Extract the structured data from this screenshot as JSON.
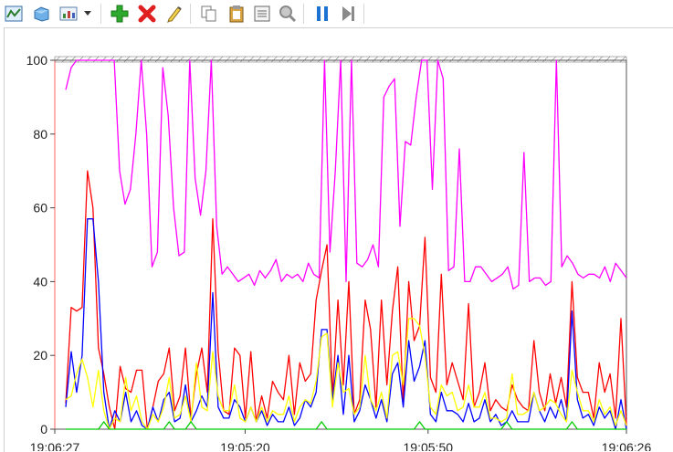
{
  "toolbar": {
    "buttons": [
      {
        "name": "view-graph-button",
        "icon": "graph-view-icon"
      },
      {
        "name": "view-histogram-button",
        "icon": "histogram-view-icon"
      },
      {
        "name": "view-report-button",
        "icon": "report-view-icon"
      },
      {
        "name": "view-dropdown-button",
        "icon": "chevron-down-icon"
      },
      {
        "name": "add-counter-button",
        "icon": "plus-icon"
      },
      {
        "name": "delete-counter-button",
        "icon": "delete-x-icon"
      },
      {
        "name": "highlight-button",
        "icon": "highlighter-icon"
      },
      {
        "name": "copy-properties-button",
        "icon": "copy-icon"
      },
      {
        "name": "paste-counter-list-button",
        "icon": "paste-icon"
      },
      {
        "name": "properties-button",
        "icon": "properties-icon"
      },
      {
        "name": "zoom-button",
        "icon": "magnifier-icon"
      },
      {
        "name": "freeze-display-button",
        "icon": "pause-icon"
      },
      {
        "name": "update-data-button",
        "icon": "step-forward-icon"
      }
    ]
  },
  "chart_data": {
    "type": "line",
    "title": "",
    "xlabel": "",
    "ylabel": "",
    "ylim": [
      0,
      100
    ],
    "yticks": [
      0,
      20,
      40,
      60,
      80,
      100
    ],
    "x_tick_labels": [
      "19:06:27",
      "19:05:20",
      "19:05:50",
      "19:06:26"
    ],
    "grid": false,
    "series": [
      {
        "color": "#ff00ff",
        "values": [
          92,
          98,
          100,
          100,
          100,
          100,
          100,
          100,
          100,
          100,
          70,
          61,
          65,
          80,
          100,
          80,
          44,
          48,
          98,
          85,
          60,
          47,
          48,
          100,
          68,
          58,
          70,
          100,
          55,
          42,
          44,
          42,
          40,
          41,
          42,
          39,
          43,
          41,
          43,
          46,
          40,
          42,
          41,
          42,
          40,
          45,
          42,
          41,
          100,
          48,
          70,
          100,
          40,
          100,
          45,
          44,
          46,
          50,
          44,
          90,
          93,
          95,
          55,
          78,
          77,
          90,
          100,
          100,
          65,
          100,
          95,
          43,
          44,
          76,
          40,
          40,
          44,
          44,
          42,
          40,
          41,
          42,
          44,
          38,
          39,
          75,
          40,
          41,
          41,
          39,
          40,
          100,
          44,
          47,
          45,
          42,
          41,
          42,
          42,
          41,
          44,
          40,
          45,
          43,
          41
        ]
      },
      {
        "color": "#ff0000",
        "values": [
          7,
          33,
          32,
          33,
          70,
          60,
          22,
          15,
          6,
          0,
          17,
          11,
          10,
          16,
          16,
          0,
          6,
          13,
          15,
          22,
          5,
          9,
          22,
          3,
          15,
          22,
          10,
          57,
          21,
          5,
          4,
          22,
          20,
          3,
          21,
          2,
          9,
          3,
          13,
          10,
          8,
          20,
          4,
          18,
          13,
          15,
          35,
          43,
          50,
          9,
          35,
          12,
          40,
          4,
          8,
          35,
          27,
          6,
          35,
          12,
          32,
          44,
          7,
          40,
          24,
          28,
          52,
          14,
          10,
          42,
          12,
          18,
          13,
          8,
          34,
          6,
          10,
          18,
          5,
          8,
          6,
          5,
          12,
          8,
          6,
          5,
          24,
          10,
          5,
          15,
          7,
          14,
          6,
          40,
          14,
          10,
          10,
          3,
          18,
          10,
          15,
          3,
          30,
          1
        ]
      },
      {
        "color": "#0000ff",
        "values": [
          6,
          21,
          10,
          20,
          57,
          57,
          40,
          10,
          0,
          5,
          2,
          10,
          2,
          5,
          1,
          0,
          6,
          2,
          8,
          10,
          2,
          3,
          12,
          2,
          5,
          9,
          6,
          37,
          6,
          3,
          3,
          8,
          6,
          2,
          6,
          2,
          5,
          1,
          4,
          2,
          2,
          6,
          1,
          3,
          8,
          6,
          10,
          27,
          27,
          8,
          20,
          4,
          20,
          2,
          5,
          12,
          8,
          3,
          8,
          2,
          15,
          18,
          6,
          24,
          13,
          17,
          24,
          4,
          2,
          10,
          5,
          5,
          4,
          2,
          7,
          2,
          3,
          8,
          2,
          4,
          1,
          2,
          5,
          2,
          2,
          2,
          10,
          5,
          2,
          6,
          3,
          8,
          2,
          32,
          8,
          3,
          4,
          1,
          6,
          3,
          5,
          0,
          8,
          0
        ]
      },
      {
        "color": "#ffff00",
        "values": [
          8,
          9,
          15,
          19,
          14,
          6,
          16,
          5,
          0,
          3,
          2,
          14,
          5,
          9,
          2,
          0,
          4,
          2,
          6,
          14,
          3,
          4,
          9,
          2,
          18,
          6,
          5,
          21,
          9,
          5,
          5,
          12,
          3,
          2,
          6,
          2,
          6,
          2,
          5,
          4,
          4,
          9,
          2,
          6,
          8,
          7,
          13,
          25,
          26,
          6,
          18,
          10,
          11,
          4,
          6,
          20,
          8,
          5,
          10,
          3,
          20,
          21,
          12,
          30,
          30,
          28,
          20,
          6,
          4,
          12,
          9,
          10,
          5,
          6,
          12,
          6,
          6,
          10,
          3,
          3,
          2,
          3,
          15,
          4,
          4,
          5,
          10,
          5,
          6,
          8,
          7,
          4,
          2,
          16,
          10,
          5,
          5,
          2,
          8,
          4,
          6,
          1,
          5,
          1
        ]
      },
      {
        "color": "#00cc00",
        "values": [
          0,
          0,
          0,
          0,
          0,
          0,
          0,
          2,
          0,
          0,
          0,
          0,
          0,
          0,
          0,
          0,
          0,
          0,
          0,
          2,
          0,
          0,
          0,
          2,
          0,
          0,
          0,
          0,
          0,
          0,
          0,
          0,
          0,
          0,
          0,
          0,
          0,
          0,
          0,
          0,
          0,
          0,
          0,
          0,
          0,
          0,
          0,
          2,
          0,
          0,
          0,
          0,
          0,
          0,
          0,
          0,
          0,
          0,
          0,
          0,
          0,
          0,
          0,
          0,
          0,
          2,
          0,
          0,
          0,
          0,
          0,
          0,
          0,
          0,
          0,
          0,
          0,
          0,
          0,
          0,
          0,
          2,
          0,
          0,
          0,
          0,
          0,
          0,
          0,
          0,
          0,
          0,
          0,
          2,
          0,
          0,
          0,
          0,
          0,
          0,
          0,
          0,
          0,
          0
        ]
      }
    ]
  }
}
